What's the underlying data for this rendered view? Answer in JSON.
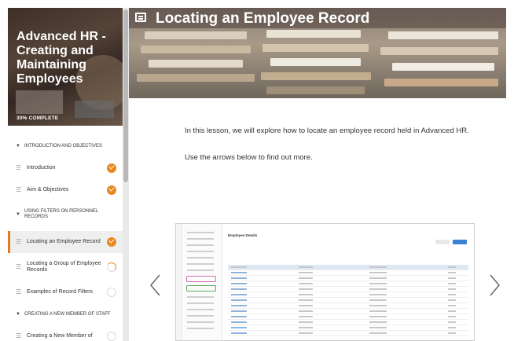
{
  "sidebar": {
    "course_title": "Advanced HR - Creating and Maintaining Employees",
    "progress_text": "30% COMPLETE",
    "progress_fraction": 0.3,
    "sections": [
      {
        "title": "INTRODUCTION AND OBJECTIVES",
        "items": [
          {
            "label": "Introduction",
            "status": "done"
          },
          {
            "label": "Aim & Objectives",
            "status": "done"
          }
        ]
      },
      {
        "title": "USING FILTERS ON PERSONNEL RECORDS",
        "items": [
          {
            "label": "Locating an Employee Record",
            "status": "done",
            "active": true
          },
          {
            "label": "Locating a Group of Employee Records",
            "status": "partial"
          },
          {
            "label": "Examples of Record Filters",
            "status": "empty"
          }
        ]
      },
      {
        "title": "CREATING A NEW MEMBER OF STAFF",
        "items": [
          {
            "label": "Creating a New Member of",
            "status": "empty"
          }
        ]
      }
    ]
  },
  "lesson": {
    "title": "Locating an Employee Record",
    "paragraphs": [
      "In this lesson, we will explore how to locate an employee record held in Advanced HR.",
      "Use the arrows below to find out more."
    ]
  },
  "embedded_screenshot": {
    "heading": "Employee Details"
  },
  "colors": {
    "accent": "#e9881f",
    "text": "#333333"
  },
  "icons": {
    "menu": "menu-icon",
    "prev": "chevron-left-icon",
    "next": "chevron-right-icon"
  }
}
